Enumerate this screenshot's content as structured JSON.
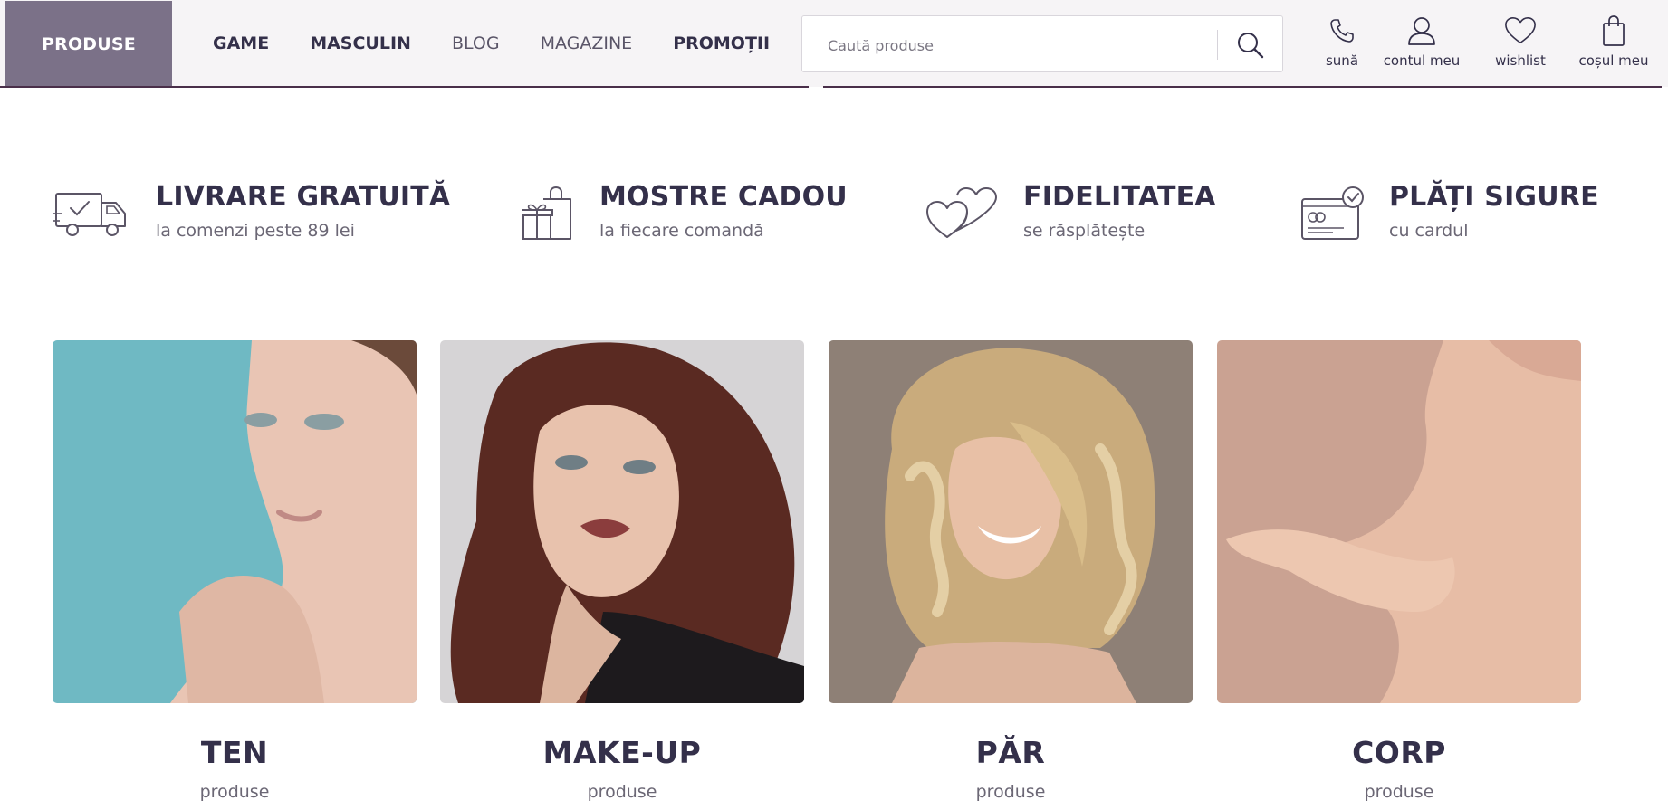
{
  "header": {
    "produse_label": "PRODUSE",
    "nav": [
      {
        "label": "GAME",
        "style": "bold"
      },
      {
        "label": "MASCULIN",
        "style": "bold"
      },
      {
        "label": "BLOG",
        "style": "light"
      },
      {
        "label": "MAGAZINE",
        "style": "light"
      },
      {
        "label": "PROMOȚII",
        "style": "bold"
      }
    ],
    "search": {
      "placeholder": "Caută produse"
    },
    "utilities": [
      {
        "label": "sună",
        "icon": "phone-icon"
      },
      {
        "label": "contul meu",
        "icon": "user-icon"
      },
      {
        "label": "wishlist",
        "icon": "heart-icon"
      },
      {
        "label": "coșul meu",
        "icon": "shopping-bag-icon"
      }
    ]
  },
  "benefits": [
    {
      "title": "LIVRARE GRATUITĂ",
      "subtitle": "la comenzi peste 89 lei",
      "icon": "delivery-truck-icon"
    },
    {
      "title": "MOSTRE CADOU",
      "subtitle": "la fiecare comandă",
      "icon": "gift-bag-icon"
    },
    {
      "title": "FIDELITATEA",
      "subtitle": "se răsplătește",
      "icon": "two-hearts-icon"
    },
    {
      "title": "PLĂȚI SIGURE",
      "subtitle": "cu cardul",
      "icon": "secure-card-icon"
    }
  ],
  "categories": [
    {
      "title": "TEN",
      "subtitle": "produse",
      "image": "face-skin-photo"
    },
    {
      "title": "MAKE-UP",
      "subtitle": "produse",
      "image": "makeup-model-photo"
    },
    {
      "title": "PĂR",
      "subtitle": "produse",
      "image": "blonde-hair-photo"
    },
    {
      "title": "CORP",
      "subtitle": "produse",
      "image": "body-skin-photo"
    }
  ],
  "colors": {
    "brand_purple": "#7b7188",
    "text_dark": "#34304a",
    "header_bg": "#f6f4f6"
  }
}
